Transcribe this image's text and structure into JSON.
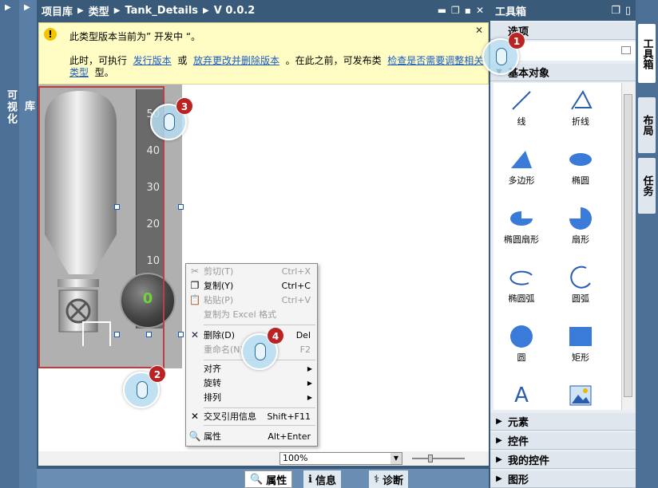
{
  "left_strip": {
    "title": "可视化",
    "sub": "库"
  },
  "titlebar": {
    "crumbs": [
      "项目库",
      "类型",
      "Tank_Details",
      "V 0.0.2"
    ]
  },
  "notification": {
    "line1": "此类型版本当前为” 开发中 “。",
    "line2_prefix": "此时，可执行",
    "link_release": "发行版本",
    "or": "或",
    "link_discard": "放弃更改并删除版本",
    "mid": "。在此之前，可发布类",
    "link_check": "检查是否需要调整相关类型",
    "suffix": "型。"
  },
  "scale": {
    "ticks": [
      "50",
      "40",
      "30",
      "20",
      "10"
    ]
  },
  "gauge": {
    "value": "0"
  },
  "context_menu": {
    "cut": {
      "label": "剪切(T)",
      "shortcut": "Ctrl+X"
    },
    "copy": {
      "label": "复制(Y)",
      "shortcut": "Ctrl+C"
    },
    "paste": {
      "label": "粘贴(P)",
      "shortcut": "Ctrl+V"
    },
    "copy_excel": {
      "label": "复制为 Excel 格式"
    },
    "delete": {
      "label": "删除(D)",
      "shortcut": "Del"
    },
    "rename": {
      "label": "重命名(N)",
      "shortcut": "F2"
    },
    "align": {
      "label": "对齐"
    },
    "rotate": {
      "label": "旋转"
    },
    "arrange": {
      "label": "排列"
    },
    "xref": {
      "label": "交叉引用信息",
      "shortcut": "Shift+F11"
    },
    "properties": {
      "label": "属性",
      "shortcut": "Alt+Enter"
    }
  },
  "zoom": {
    "value": "100%"
  },
  "bottom_tabs": {
    "properties": "属性",
    "info": "信息",
    "diagnostics": "诊断"
  },
  "toolbox": {
    "title": "工具箱",
    "options": "选项",
    "basic_objects": "基本对象",
    "tools": [
      {
        "label": "线",
        "icon": "line-icon"
      },
      {
        "label": "折线",
        "icon": "polyline-icon"
      },
      {
        "label": "多边形",
        "icon": "polygon-icon"
      },
      {
        "label": "椭圆",
        "icon": "ellipse-icon"
      },
      {
        "label": "椭圆扇形",
        "icon": "ellipse-segment-icon"
      },
      {
        "label": "扇形",
        "icon": "circle-segment-icon"
      },
      {
        "label": "椭圆弧",
        "icon": "ellipse-arc-icon"
      },
      {
        "label": "圆弧",
        "icon": "circle-arc-icon"
      },
      {
        "label": "圆",
        "icon": "circle-icon"
      },
      {
        "label": "矩形",
        "icon": "rectangle-icon"
      },
      {
        "label": "",
        "icon": "text-icon",
        "glyph": "A"
      },
      {
        "label": "",
        "icon": "graphic-view-icon"
      }
    ],
    "sections": [
      "元素",
      "控件",
      "我的控件",
      "图形"
    ]
  },
  "right_tabs": [
    "工具箱",
    "布局",
    "任务"
  ],
  "callouts": [
    "1",
    "2",
    "3",
    "4"
  ]
}
